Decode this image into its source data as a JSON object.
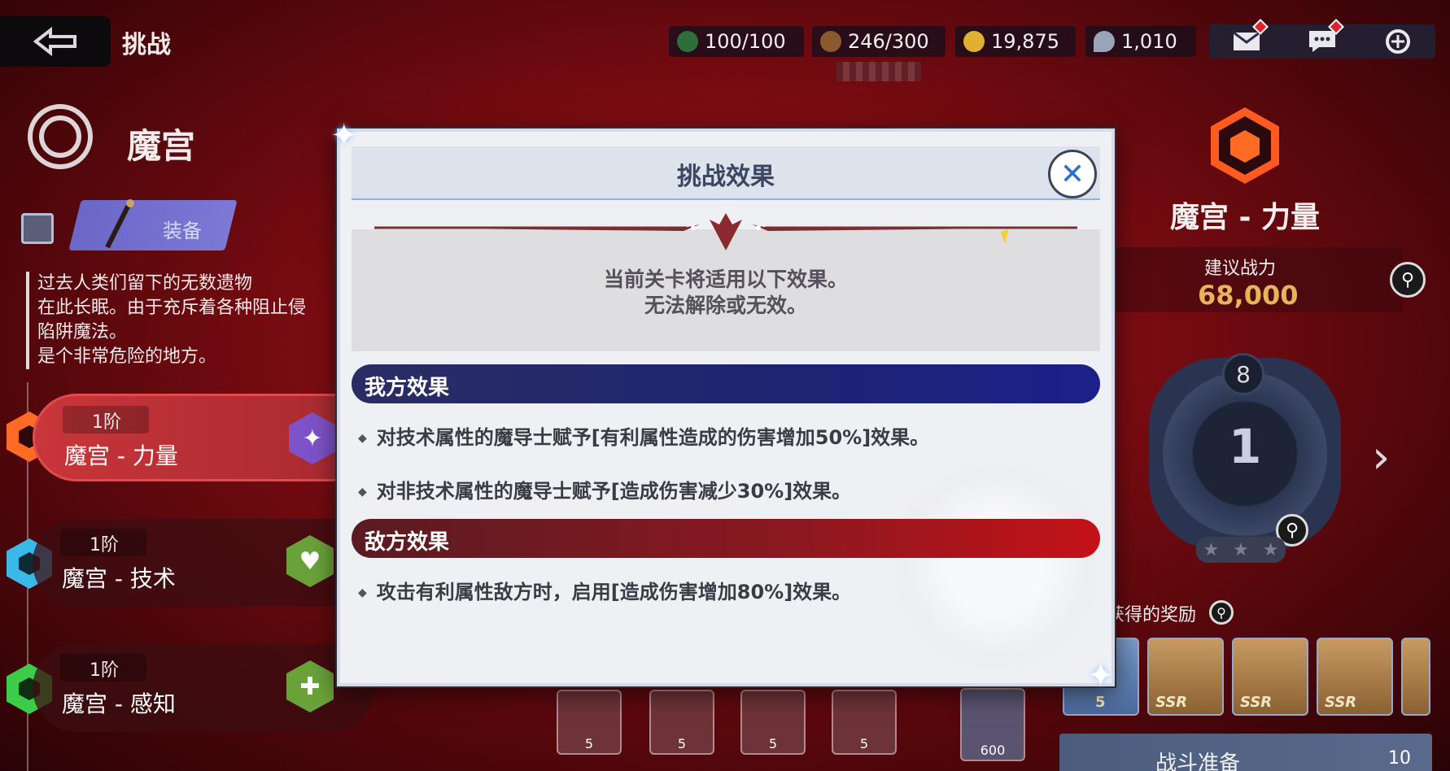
{
  "header": {
    "title": "挑战",
    "resources": [
      {
        "name": "stamina",
        "value": "100/100",
        "color": "#2f6d3a"
      },
      {
        "name": "boots",
        "value": "246/300",
        "color": "#8a5a2e"
      },
      {
        "name": "gold",
        "value": "19,875",
        "color": "#e0b030"
      },
      {
        "name": "crystal",
        "value": "1,010",
        "color": "#9aa4b8"
      }
    ],
    "icons": [
      "mail-icon",
      "chat-icon",
      "menu-icon"
    ]
  },
  "left": {
    "dungeon_title": "魔宫",
    "equip_label": "装备",
    "description": "过去人类们留下的无数遗物\n在此长眠。由于充斥着各种阻止侵\n陷阱魔法。\n是个非常危险的地方。",
    "stages": [
      {
        "tier": "1阶",
        "name": "魔宫 - 力量",
        "color": "#ff6a24"
      },
      {
        "tier": "1阶",
        "name": "魔宫 - 技术",
        "color": "#3ab8e8"
      },
      {
        "tier": "1阶",
        "name": "魔宫 - 感知",
        "color": "#3dcc4a"
      }
    ]
  },
  "right": {
    "stage_title": "魔宫 - 力量",
    "power_label": "建议战力",
    "power_value": "68,000",
    "floor": "1",
    "floor_top": "8",
    "reward_label": "获得的奖励",
    "rewards": [
      {
        "tag": "",
        "count": "5"
      },
      {
        "tag": "SSR"
      },
      {
        "tag": "SSR"
      },
      {
        "tag": "SSR"
      }
    ],
    "battle_label": "战斗准备",
    "battle_cost": "10"
  },
  "bottom_items": [
    "5",
    "5",
    "5",
    "5",
    "600"
  ],
  "modal": {
    "title": "挑战效果",
    "notice": "当前关卡将适用以下效果。\n无法解除或无效。",
    "ally_header": "我方效果",
    "ally_effects": [
      "对技术属性的魔导士赋予[有利属性造成的伤害增加50%]效果。",
      "对非技术属性的魔导士赋予[造成伤害减少30%]效果。"
    ],
    "enemy_header": "敌方效果",
    "enemy_effects": [
      "攻击有利属性敌方时，启用[造成伤害增加80%]效果。"
    ]
  }
}
